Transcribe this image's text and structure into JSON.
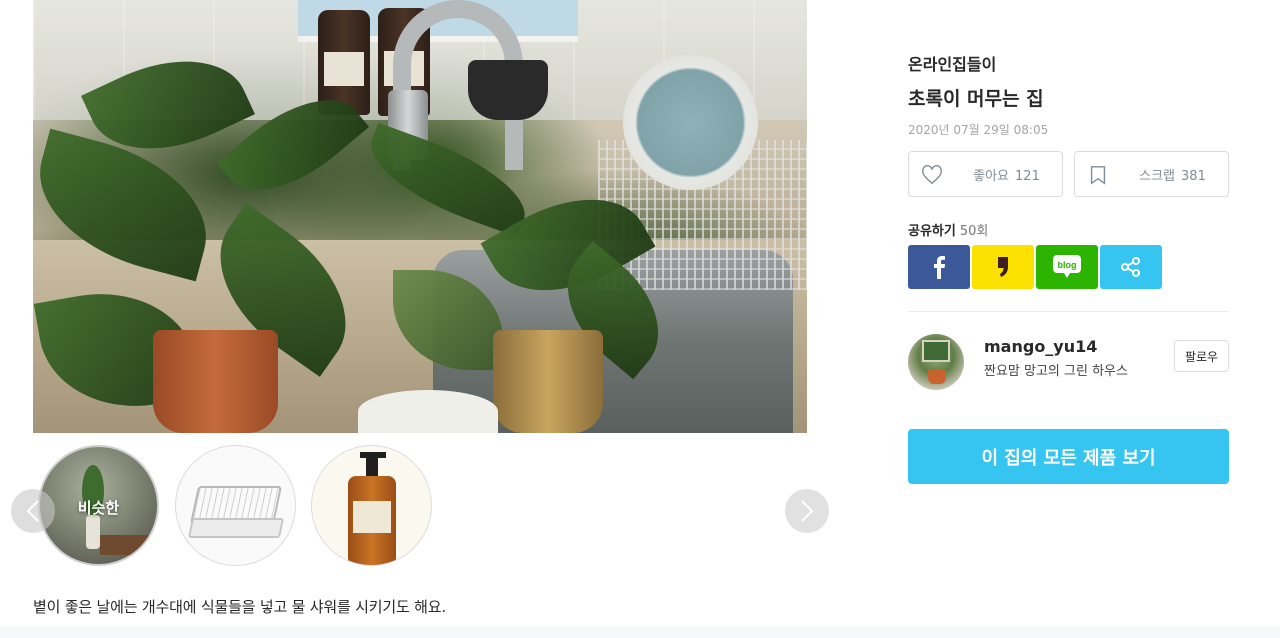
{
  "photo": {
    "thumbnails": [
      {
        "label": "비슷한",
        "kind": "similar"
      },
      {
        "label": "",
        "kind": "product-dish-rack"
      },
      {
        "label": "",
        "kind": "product-hand-wash"
      }
    ]
  },
  "caption": "볕이 좋은 날에는 개수대에 식물들을 넣고 물 샤워를 시키기도 해요.",
  "sidebar": {
    "category": "온라인집들이",
    "title": "초록이 머무는 집",
    "date": "2020년 07월 29일 08:05",
    "like": {
      "label": "좋아요",
      "count": "121",
      "icon": "heart-icon"
    },
    "scrap": {
      "label": "스크랩",
      "count": "381",
      "icon": "bookmark-icon"
    },
    "share": {
      "label": "공유하기",
      "count": "50회",
      "buttons": [
        {
          "name": "facebook",
          "icon": "facebook-icon",
          "color": "#3b5998"
        },
        {
          "name": "kakaostory",
          "icon": "kakaostory-icon",
          "color": "#fae100"
        },
        {
          "name": "blog",
          "icon": "naver-blog-icon",
          "text": "blog",
          "color": "#2db400"
        },
        {
          "name": "url",
          "icon": "share-icon",
          "color": "#35c5f0"
        }
      ]
    },
    "author": {
      "username": "mango_yu14",
      "description": "짠요맘 망고의 그린 하우스",
      "follow_label": "팔로우"
    },
    "all_products_label": "이 집의 모든 제품 보기"
  },
  "colors": {
    "accent": "#35c5f0",
    "text": "#292929",
    "muted": "#828c94",
    "facebook": "#3b5998",
    "kakao": "#fae100",
    "naver": "#2db400"
  }
}
